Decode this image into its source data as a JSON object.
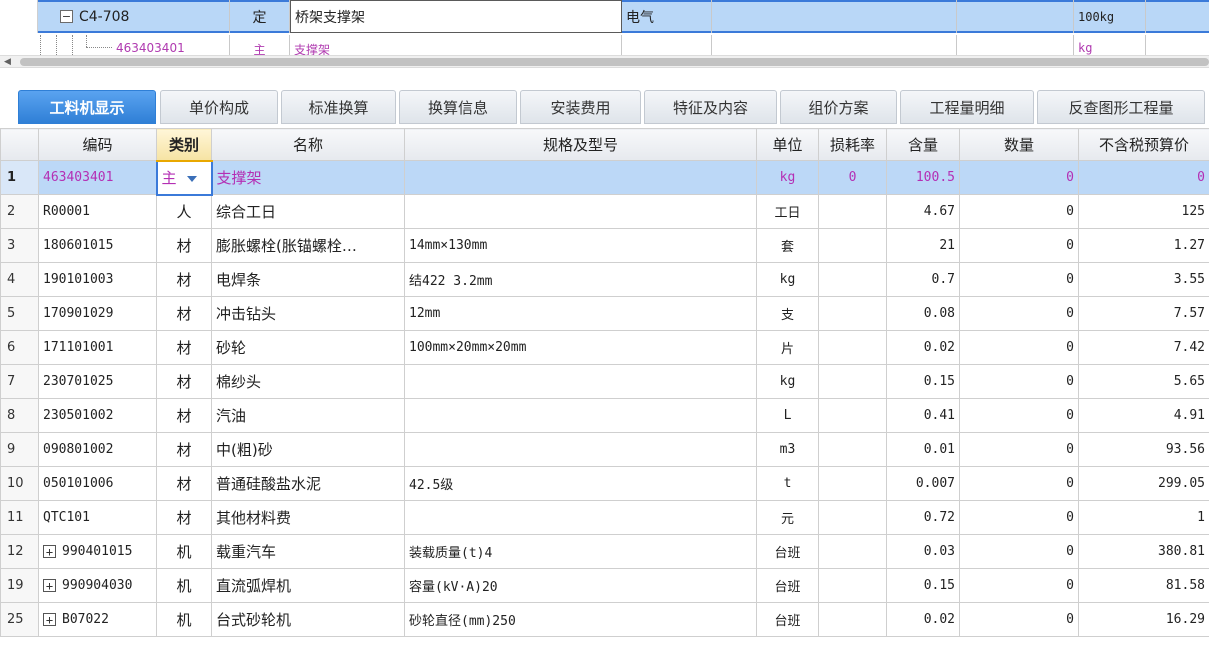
{
  "top_tree": {
    "row1": {
      "collapse_symbol": "−",
      "code": "C4-708",
      "type": "定",
      "name": "桥架支撑架",
      "category": "电气",
      "unit": "100kg"
    },
    "row2": {
      "code": "463403401",
      "type": "主",
      "name": "支撑架",
      "unit": "kg"
    }
  },
  "scrollbar": {
    "left_arrow": "◀"
  },
  "tabs": [
    {
      "label": "工料机显示",
      "active": true
    },
    {
      "label": "单价构成"
    },
    {
      "label": "标准换算"
    },
    {
      "label": "换算信息"
    },
    {
      "label": "安装费用"
    },
    {
      "label": "特征及内容"
    },
    {
      "label": "组价方案"
    },
    {
      "label": "工程量明细"
    },
    {
      "label": "反查图形工程量"
    }
  ],
  "table": {
    "headers": {
      "code": "编码",
      "type": "类别",
      "name": "名称",
      "spec": "规格及型号",
      "unit": "单位",
      "loss": "损耗率",
      "content": "含量",
      "qty": "数量",
      "price": "不含税预算价"
    },
    "rows": [
      {
        "no": "1",
        "code": "463403401",
        "type": "主",
        "name": "支撑架",
        "spec": "",
        "unit": "kg",
        "loss": "0",
        "content": "100.5",
        "qty": "0",
        "price": "0"
      },
      {
        "no": "2",
        "code": "R00001",
        "type": "人",
        "name": "综合工日",
        "spec": "",
        "unit": "工日",
        "loss": "",
        "content": "4.67",
        "qty": "0",
        "price": "125"
      },
      {
        "no": "3",
        "code": "180601015",
        "type": "材",
        "name": "膨胀螺栓(胀锚螺栓…",
        "spec": "14mm×130mm",
        "unit": "套",
        "loss": "",
        "content": "21",
        "qty": "0",
        "price": "1.27"
      },
      {
        "no": "4",
        "code": "190101003",
        "type": "材",
        "name": "电焊条",
        "spec": "结422 3.2mm",
        "unit": "kg",
        "loss": "",
        "content": "0.7",
        "qty": "0",
        "price": "3.55"
      },
      {
        "no": "5",
        "code": "170901029",
        "type": "材",
        "name": "冲击钻头",
        "spec": "12mm",
        "unit": "支",
        "loss": "",
        "content": "0.08",
        "qty": "0",
        "price": "7.57"
      },
      {
        "no": "6",
        "code": "171101001",
        "type": "材",
        "name": "砂轮",
        "spec": "100mm×20mm×20mm",
        "unit": "片",
        "loss": "",
        "content": "0.02",
        "qty": "0",
        "price": "7.42"
      },
      {
        "no": "7",
        "code": "230701025",
        "type": "材",
        "name": "棉纱头",
        "spec": "",
        "unit": "kg",
        "loss": "",
        "content": "0.15",
        "qty": "0",
        "price": "5.65"
      },
      {
        "no": "8",
        "code": "230501002",
        "type": "材",
        "name": "汽油",
        "spec": "",
        "unit": "L",
        "loss": "",
        "content": "0.41",
        "qty": "0",
        "price": "4.91"
      },
      {
        "no": "9",
        "code": "090801002",
        "type": "材",
        "name": "中(粗)砂",
        "spec": "",
        "unit": "m3",
        "loss": "",
        "content": "0.01",
        "qty": "0",
        "price": "93.56"
      },
      {
        "no": "10",
        "code": "050101006",
        "type": "材",
        "name": "普通硅酸盐水泥",
        "spec": "42.5级",
        "unit": "t",
        "loss": "",
        "content": "0.007",
        "qty": "0",
        "price": "299.05"
      },
      {
        "no": "11",
        "code": "QTC101",
        "type": "材",
        "name": "其他材料费",
        "spec": "",
        "unit": "元",
        "loss": "",
        "content": "0.72",
        "qty": "0",
        "price": "1"
      },
      {
        "no": "12",
        "code": "990401015",
        "expand": "+",
        "type": "机",
        "name": "载重汽车",
        "spec": "装载质量(t)4",
        "unit": "台班",
        "loss": "",
        "content": "0.03",
        "qty": "0",
        "price": "380.81"
      },
      {
        "no": "19",
        "code": "990904030",
        "expand": "+",
        "type": "机",
        "name": "直流弧焊机",
        "spec": "容量(kV·A)20",
        "unit": "台班",
        "loss": "",
        "content": "0.15",
        "qty": "0",
        "price": "81.58"
      },
      {
        "no": "25",
        "code": "B07022",
        "expand": "+",
        "type": "机",
        "name": "台式砂轮机",
        "spec": "砂轮直径(mm)250",
        "unit": "台班",
        "loss": "",
        "content": "0.02",
        "qty": "0",
        "price": "16.29"
      }
    ]
  }
}
